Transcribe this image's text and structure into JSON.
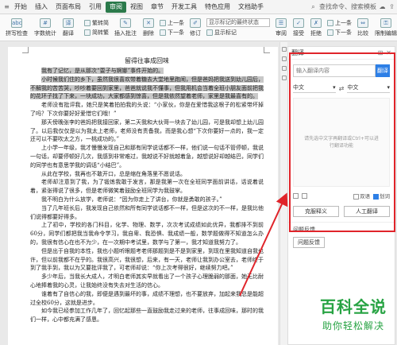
{
  "ribbon": {
    "tabs": [
      "开始",
      "插入",
      "页面布局",
      "引用",
      "审阅",
      "视图",
      "章节",
      "开发工具",
      "特色应用",
      "文档助手"
    ],
    "active_tab": "审阅",
    "search_tip": "查找命令、搜索模板"
  },
  "toolbar": {
    "buttons": [
      {
        "label": "拼写检查"
      },
      {
        "label": "字数统计"
      },
      {
        "label": "翻译"
      }
    ],
    "simp_trad": {
      "row1": "繁转简",
      "row2": "简转繁"
    },
    "insert_comment": "插入批注",
    "delete": "删除",
    "prev": "上一条",
    "next": "下一条",
    "revise": "修订",
    "markup_select": "显示标记的最终状态",
    "show_markup": "显示标记",
    "review": "审阅",
    "accept": "接受",
    "reject": "拒绝",
    "prev2": "上一条",
    "next2": "下一条",
    "compare": "比较",
    "restrict": "限制编辑"
  },
  "document": {
    "title": "留得往事成回味",
    "paragraphs": [
      {
        "text": "我有了记忆，是从那次“耍子与婀娜”事件开始的。",
        "highlight": true
      },
      {
        "text": "小时候我们住的乡下，虽然我很喜欢带着糖去大堂地里跑闹，但是爸妈把我送到幼儿园后，不解我的苦苦哭，吵吵着要回到家里，爸爸就说我不懂事，但我用机会当着全班小朋友面前把我的花环子找了下来，一块成功，大家都感到惊喜，但是我依然望着老师，家里是我最喜有的。",
        "highlight": true
      },
      {
        "text": "老师没有批评我，她只是笑着拍拍我的头说：“小家伙，你是在爱惜我这根子的松紧带坏掉了吗？下次你要好好爱惜它们哦！”",
        "highlight": false
      },
      {
        "text": "那天傍晚张李的爸妈把我接回家，第二天我和大伙哥一块去了幼儿园，可是我却想上幼儿园了。以后我仅仅是以为我太上老师，老师没有责备我，而是我心想“下次你要好一点的，我一定还可以不要吹太之方，一桃成功的。”",
        "highlight": false
      },
      {
        "text": "上小学一年级，我才慢慢发现自己和那有同学说话都不一样，他们说一句话不管停顿，我说一句话，却要停顿好几次，我感到非常难过，我越说不好就越着急，越想说好却越结巴，同学们的同学也有意思学我的调话“小结巴”。",
        "highlight": false
      },
      {
        "text": "从此在学校，我再也不敢开口，总是缩在角落里不愿说话。",
        "highlight": false
      },
      {
        "text": "老师却注意到了我，为了锻炼我敢于发言，那是我第一次在全班同学面前讲话，话说着说着，紧张得说了很多，但是老师微笑着鼓励全班同学为我鼓掌。",
        "highlight": false
      },
      {
        "text": "我不明白为什么放学，老师说：“因为你走上了讲台，你就是勇敢的孩子。”",
        "highlight": false
      },
      {
        "text": "当了几年班长后，我发现自己依然和所有同学说话都不一样，但是这次的不一样，是我比他们说得都要好得多。",
        "highlight": false
      },
      {
        "text": "上了初中，学校的各门科目，化学、物理、数学，次次考试成绩如此优异，我都排不到前60分，同学们都把我当我命令学习，我自卑、我恐惧、我成绩一般，数学题做得不知道怎么办的，我很有信心在也不为少，在一次期中考试里，数学与了第一，我才知道我努力了。",
        "highlight": false
      },
      {
        "text": "但是出于自我的本性，我也小题听眼题考老师那题到是不是到家里，到现在里我知道自我也许，但以前我都不在乎的。我很高兴，我很想，后来，有一天，老师让我到办公室去，老师终于到了我手到，我以为又要批评我了，可老师却说：“你上次考得很好，继续努力吧。”",
        "highlight": false
      },
      {
        "text": "多少年后，当我长大成人，才明白老师其实早就看出了一个孩子心理脆弱的那面，她无比耐心地捧着我的心灵，让我始终没有失去对生活的信心。",
        "highlight": false
      },
      {
        "text": "谁着有了自信心的我，即便是遇到最坏的事，成绩不理想，也不要放弃，加起来我总是能超过全校60分，这就是进步。",
        "highlight": false
      },
      {
        "text": "如今我已经参加工作几年了，回忆起那些一直鼓励我走过来的老师，往事成回味，那时的我们一样，心中都充满了感恩。",
        "highlight": false
      }
    ]
  },
  "translate_pane": {
    "title": "翻译",
    "input_placeholder": "输入翻译内容",
    "translate_btn": "翻译",
    "source_lang": "中文",
    "target_lang": "中文",
    "result_placeholder": "请先选中文字再翻译或Ctrl+可以进行翻译功能",
    "opt_bilingual": "双语",
    "opt_replace": "划词",
    "btn_paraphrase": "克服释义",
    "btn_human": "人工翻译",
    "feedback_title": "问题反馈",
    "feedback_btn": "问题反馈"
  },
  "watermark": {
    "main": "百科全说",
    "sub": "助你轻松解决"
  },
  "colors": {
    "active_tab": "#2b7a4b",
    "accent_blue": "#2d7fe6",
    "annotation_red": "#e0242a",
    "watermark_green": "#27a343"
  }
}
